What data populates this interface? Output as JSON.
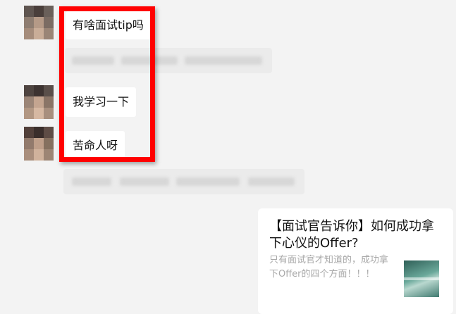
{
  "messages": [
    {
      "text": "有啥面试tip吗"
    },
    {
      "text": "我学习一下"
    },
    {
      "text": "苦命人呀"
    }
  ],
  "shared_card": {
    "title": "【面试官告诉你】如何成功拿下心仪的Offer?",
    "description": "只有面试官才知道的，成功拿下Offer的四个方面！！！"
  },
  "colors": {
    "background": "#f3f3f3",
    "bubble": "#ffffff",
    "highlight_border": "#ff0000"
  }
}
